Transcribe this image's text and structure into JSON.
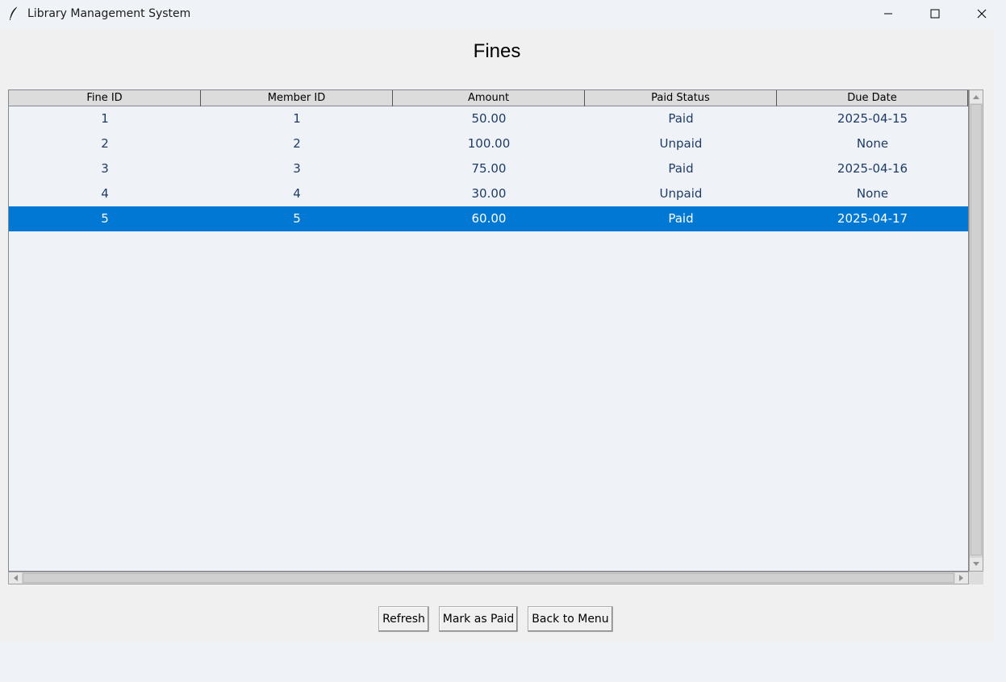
{
  "window": {
    "title": "Library Management System",
    "icon": "feather-icon",
    "controls": [
      "minimize-icon",
      "maximize-icon",
      "close-icon"
    ]
  },
  "page": {
    "title": "Fines"
  },
  "table": {
    "columns": [
      "Fine ID",
      "Member ID",
      "Amount",
      "Paid Status",
      "Due Date"
    ],
    "rows": [
      [
        "1",
        "1",
        "50.00",
        "Paid",
        "2025-04-15"
      ],
      [
        "2",
        "2",
        "100.00",
        "Unpaid",
        "None"
      ],
      [
        "3",
        "3",
        "75.00",
        "Paid",
        "2025-04-16"
      ],
      [
        "4",
        "4",
        "30.00",
        "Unpaid",
        "None"
      ],
      [
        "5",
        "5",
        "60.00",
        "Paid",
        "2025-04-17"
      ]
    ],
    "selected_row": 4,
    "selection_color": "#0078d4"
  },
  "buttons": {
    "refresh": "Refresh",
    "mark_paid": "Mark as Paid",
    "back": "Back to Menu"
  }
}
